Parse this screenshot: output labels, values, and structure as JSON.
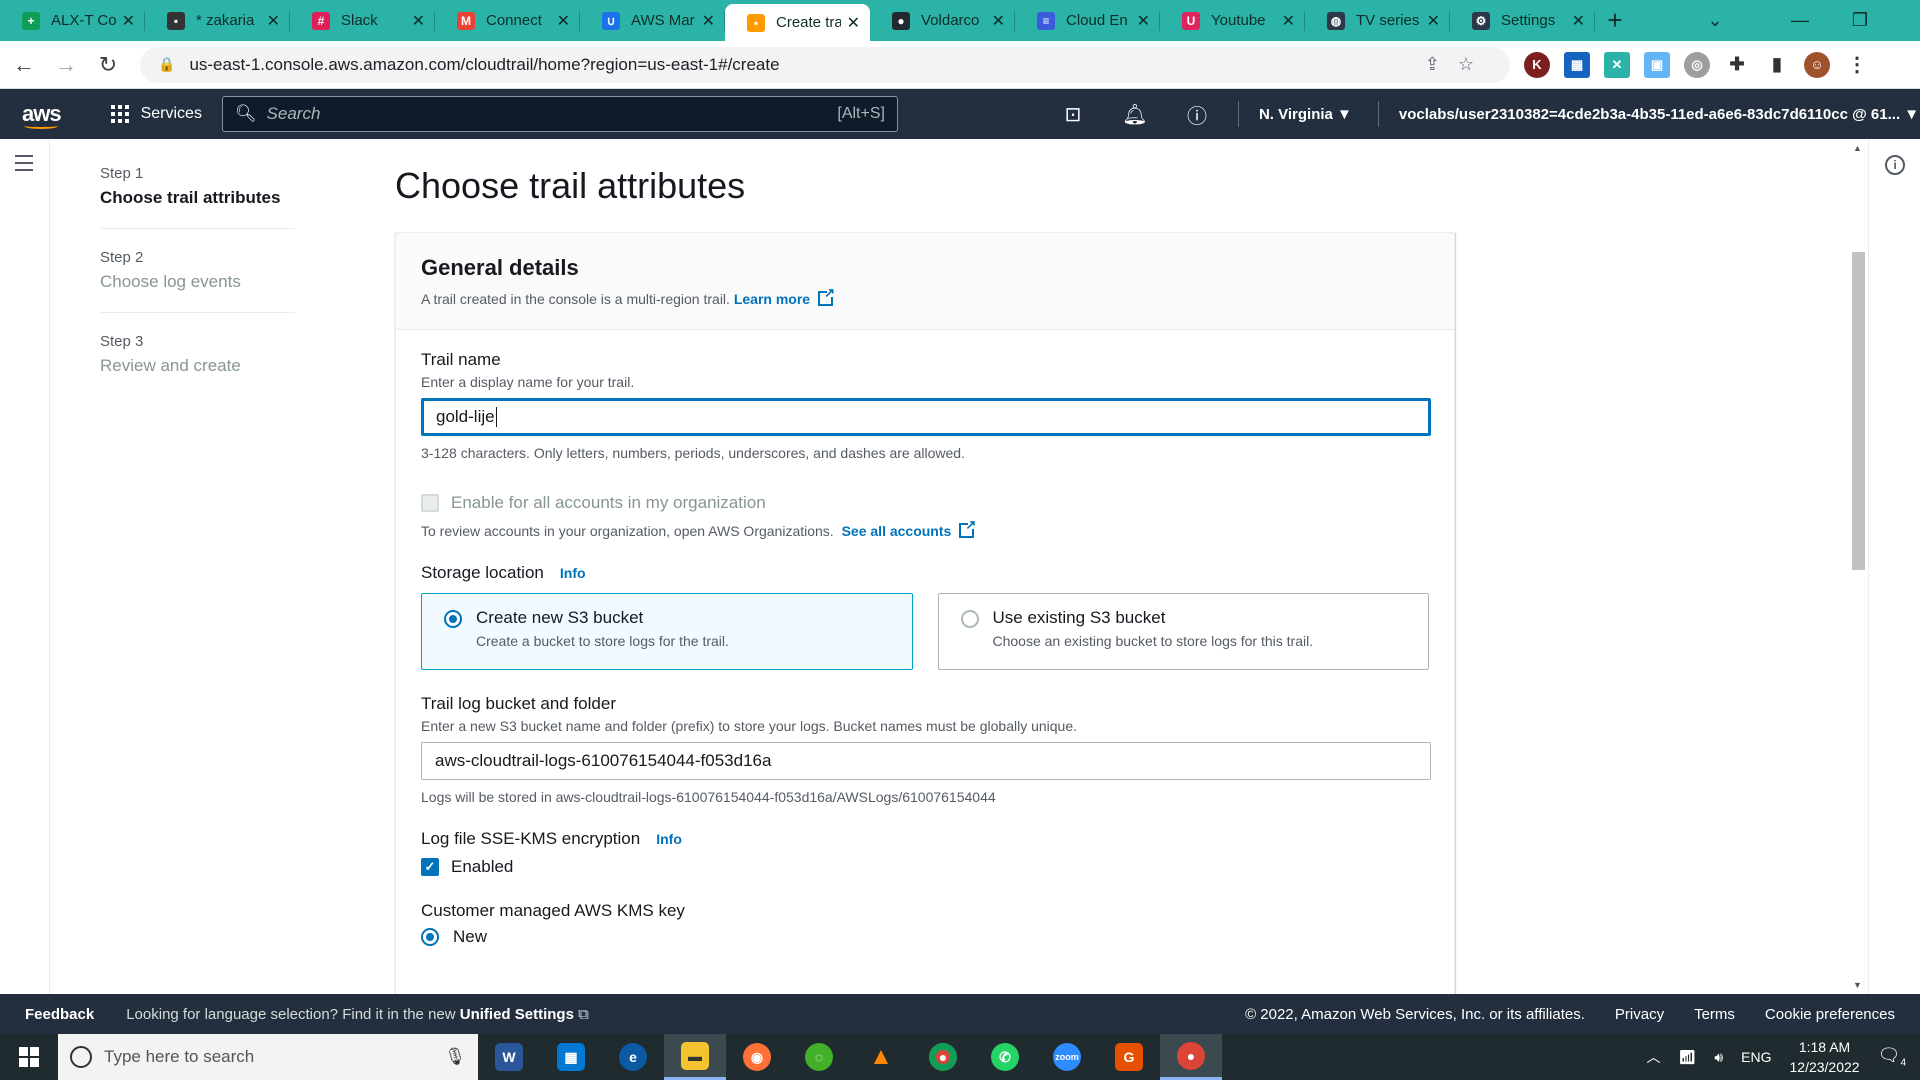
{
  "browser": {
    "tabs": [
      {
        "title": "ALX-T Co",
        "icon": "sheets-icon",
        "color": "#0f9d58",
        "glyph": "+"
      },
      {
        "title": "* zakaria",
        "icon": "docs-icon",
        "color": "#333333",
        "glyph": "▪"
      },
      {
        "title": "Slack",
        "icon": "slack-icon",
        "color": "#e01e5a",
        "glyph": "#"
      },
      {
        "title": "Connect",
        "icon": "gmail-icon",
        "color": "#ea4335",
        "glyph": "M"
      },
      {
        "title": "AWS Mar",
        "icon": "aws-academy-icon",
        "color": "#1a73e8",
        "glyph": "∪"
      },
      {
        "title": "Create tra",
        "icon": "aws-console-icon",
        "color": "#ff9900",
        "glyph": "▪"
      },
      {
        "title": "Voldarco",
        "icon": "github-icon",
        "color": "#24292f",
        "glyph": "●"
      },
      {
        "title": "Cloud En",
        "icon": "cloud-icon",
        "color": "#3b5bdb",
        "glyph": "≡"
      },
      {
        "title": "Youtube",
        "icon": "youtube-icon",
        "color": "#e0245e",
        "glyph": "U"
      },
      {
        "title": "TV series",
        "icon": "globe-icon",
        "color": "#2d3748",
        "glyph": "◍"
      },
      {
        "title": "Settings",
        "icon": "gear-icon",
        "color": "#2d3748",
        "glyph": "⚙"
      }
    ],
    "active_tab": 5,
    "url": "us-east-1.console.aws.amazon.com/cloudtrail/home?region=us-east-1#/create"
  },
  "aws_nav": {
    "logo": "aws",
    "services": "Services",
    "search_placeholder": "Search",
    "search_shortcut": "[Alt+S]",
    "region": "N. Virginia",
    "account": "voclabs/user2310382=4cde2b3a-4b35-11ed-a6e6-83dc7d6110cc @ 61..."
  },
  "steps": [
    {
      "num": "Step 1",
      "label": "Choose trail attributes",
      "current": true
    },
    {
      "num": "Step 2",
      "label": "Choose log events",
      "current": false
    },
    {
      "num": "Step 3",
      "label": "Review and create",
      "current": false
    }
  ],
  "page": {
    "title": "Choose trail attributes",
    "general": {
      "heading": "General details",
      "desc": "A trail created in the console is a multi-region trail.",
      "learn_more": "Learn more"
    },
    "trail_name": {
      "label": "Trail name",
      "desc": "Enter a display name for your trail.",
      "value": "gold-lije",
      "hint": "3-128 characters. Only letters, numbers, periods, underscores, and dashes are allowed."
    },
    "org": {
      "label": "Enable for all accounts in my organization",
      "checked": false,
      "desc": "To review accounts in your organization, open AWS Organizations.",
      "link": "See all accounts"
    },
    "storage": {
      "label": "Storage location",
      "info": "Info",
      "options": [
        {
          "title": "Create new S3 bucket",
          "desc": "Create a bucket to store logs for the trail.",
          "selected": true
        },
        {
          "title": "Use existing S3 bucket",
          "desc": "Choose an existing bucket to store logs for this trail.",
          "selected": false
        }
      ]
    },
    "bucket": {
      "label": "Trail log bucket and folder",
      "desc": "Enter a new S3 bucket name and folder (prefix) to store your logs. Bucket names must be globally unique.",
      "value": "aws-cloudtrail-logs-610076154044-f053d16a",
      "hint": "Logs will be stored in aws-cloudtrail-logs-610076154044-f053d16a/AWSLogs/610076154044"
    },
    "sse": {
      "label": "Log file SSE-KMS encryption",
      "info": "Info",
      "checkbox": "Enabled",
      "checked": true
    },
    "kms": {
      "label": "Customer managed AWS KMS key",
      "option": "New"
    }
  },
  "footer": {
    "feedback": "Feedback",
    "lang_text": "Looking for language selection? Find it in the new",
    "lang_link": "Unified Settings",
    "copyright": "© 2022, Amazon Web Services, Inc. or its affiliates.",
    "links": [
      "Privacy",
      "Terms",
      "Cookie preferences"
    ]
  },
  "taskbar": {
    "search_placeholder": "Type here to search",
    "lang": "ENG",
    "time": "1:18 AM",
    "date": "12/23/2022",
    "notifications": "4"
  },
  "colors": {
    "aws_nav": "#232f3e",
    "link": "#0073bb",
    "chrome_tab": "#2ab3a6",
    "aws_orange": "#ff9900"
  }
}
